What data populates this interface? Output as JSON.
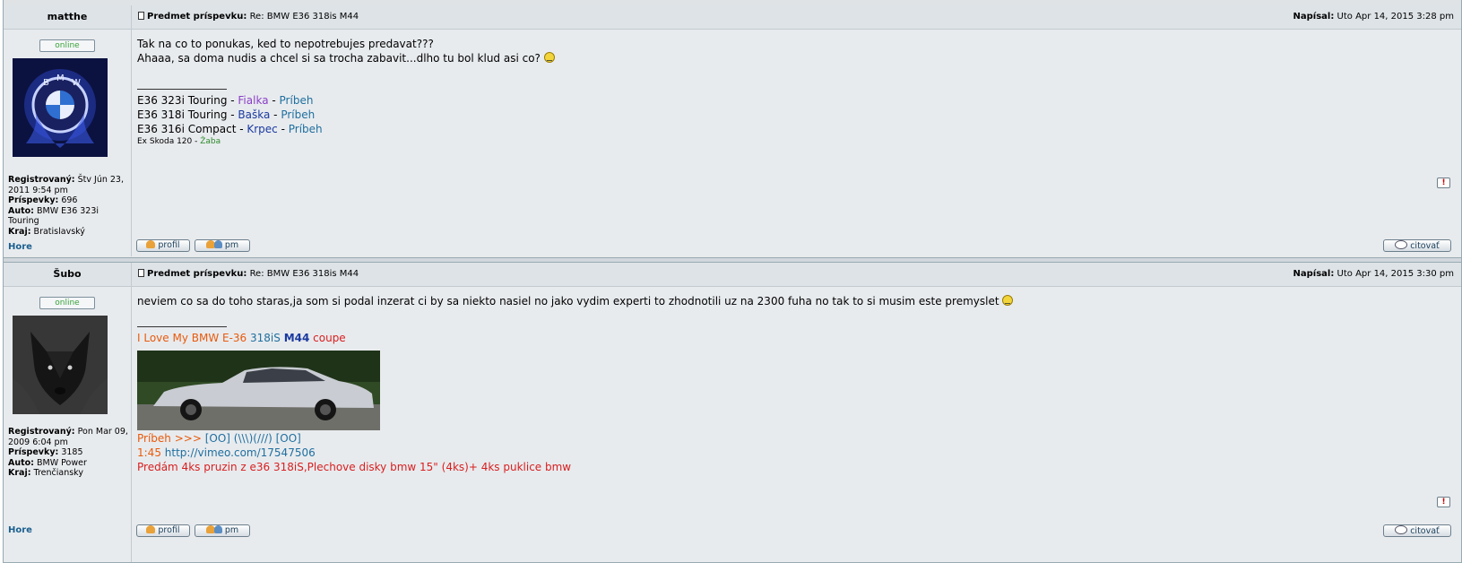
{
  "posts": [
    {
      "author": "matthe",
      "subject_label": "Predmet príspevku:",
      "subject": "Re: BMW E36 318is M44",
      "date_label": "Napísal:",
      "date": "Uto Apr 14, 2015 3:28 pm",
      "online": "online",
      "profile": [
        {
          "label": "Registrovaný:",
          "value": "Štv Jún 23, 2011 9:54 pm"
        },
        {
          "label": "Príspevky:",
          "value": "696"
        },
        {
          "label": "Auto:",
          "value": "BMW E36 323i Touring"
        },
        {
          "label": "Kraj:",
          "value": "Bratislavský"
        }
      ],
      "body": [
        "Tak na co to ponukas, ked to nepotrebujes predavat???",
        "Ahaaa, sa doma nudis a chcel si sa trocha zabavit...dlho tu bol klud asi co?"
      ],
      "sig": {
        "l1": {
          "a": "E36 323i Touring - ",
          "b": "Fialka",
          "c": " - ",
          "d": "Príbeh"
        },
        "l2": {
          "a": "E36 318i Touring - ",
          "b": "Baška",
          "c": " - ",
          "d": "Príbeh"
        },
        "l3": {
          "a": "E36 316i Compact - ",
          "b": "Krpec",
          "c": " - ",
          "d": "Príbeh"
        },
        "l4": {
          "a": "Ex Skoda 120 - ",
          "b": "Žaba"
        }
      },
      "hore": "Hore",
      "btn_profil": "profil",
      "btn_pm": "pm",
      "btn_citovat": "citovať",
      "report": "!"
    },
    {
      "author": "Šubo",
      "subject_label": "Predmet príspevku:",
      "subject": "Re: BMW E36 318is M44",
      "date_label": "Napísal:",
      "date": "Uto Apr 14, 2015 3:30 pm",
      "online": "online",
      "profile": [
        {
          "label": "Registrovaný:",
          "value": "Pon Mar 09, 2009 6:04 pm"
        },
        {
          "label": "Príspevky:",
          "value": "3185"
        },
        {
          "label": "Auto:",
          "value": "BMW Power"
        },
        {
          "label": "Kraj:",
          "value": "Trenčiansky"
        }
      ],
      "body": [
        "neviem co sa do toho staras,ja som si podal inzerat ci by sa niekto nasiel no jako vydim experti to zhodnotili uz na 2300 fuha no tak to si musim este premyslet"
      ],
      "sig": {
        "l1": {
          "a": "I Love My BMW E-36 ",
          "b": "318iS",
          "c": " ",
          "d": "M44",
          "e": " coupe"
        },
        "l2": {
          "a": "Príbeh >>> ",
          "b": "[OO] (\\\\\\)(///) [OO]"
        },
        "l3": {
          "a": "1:45 ",
          "b": "http://vimeo.com/17547506"
        },
        "l4": "Predám 4ks pruzin z e36 318iS,Plechove disky bmw 15\" (4ks)+ 4ks puklice bmw"
      },
      "hore": "Hore",
      "btn_profil": "profil",
      "btn_pm": "pm",
      "btn_citovat": "citovať",
      "report": "!"
    }
  ]
}
